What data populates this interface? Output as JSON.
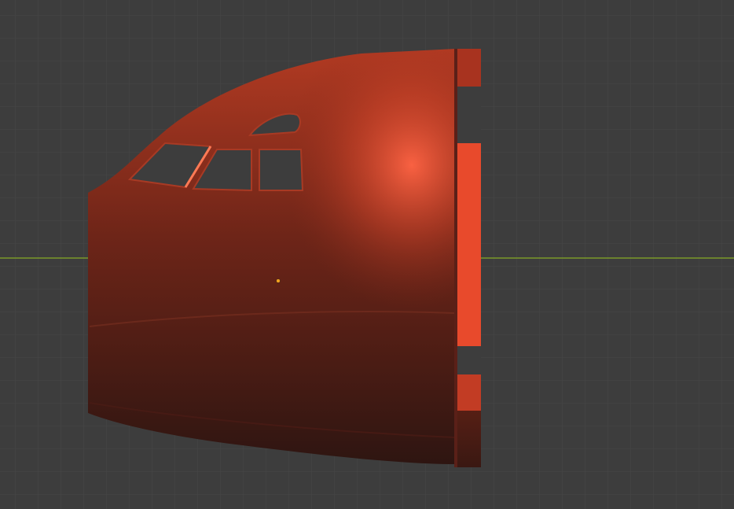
{
  "viewport": {
    "background": "#3d3d3d",
    "grid_minor_color": "#474747",
    "grid_major_color": "#525252",
    "x_axis_color": "#7b9a2a"
  },
  "model": {
    "base_color": "#8a2a1a",
    "highlight_color": "#ff6040",
    "shadow_color": "#2a1410",
    "window_color": "#3d3d3d"
  },
  "origin_marker": {
    "color": "#f0a020"
  }
}
